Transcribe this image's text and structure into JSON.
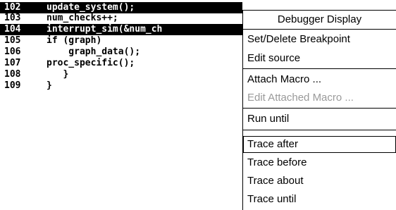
{
  "code": {
    "lines": [
      {
        "num": "102",
        "text": "update_system();"
      },
      {
        "num": "103",
        "text": "num_checks++;"
      },
      {
        "num": "104",
        "text": "interrupt_sim(&num_ch"
      },
      {
        "num": "105",
        "text": "if (graph)"
      },
      {
        "num": "106",
        "text": "    graph_data();"
      },
      {
        "num": "107",
        "text": "proc_specific();"
      },
      {
        "num": "108",
        "text": "   }"
      },
      {
        "num": "109",
        "text": "}"
      }
    ],
    "selected_lines": [
      "102",
      "104"
    ]
  },
  "popup": {
    "title": "Debugger Display",
    "items": [
      {
        "label": "Set/Delete Breakpoint",
        "enabled": true
      },
      {
        "label": "Edit source",
        "enabled": true
      },
      {
        "label": "Attach Macro ...",
        "enabled": true
      },
      {
        "label": "Edit Attached Macro ...",
        "enabled": false
      },
      {
        "label": "Run until",
        "enabled": true
      },
      {
        "label": "Trace after",
        "enabled": true,
        "highlighted": true
      },
      {
        "label": "Trace before",
        "enabled": true
      },
      {
        "label": "Trace about",
        "enabled": true
      },
      {
        "label": "Trace until",
        "enabled": true
      }
    ]
  }
}
